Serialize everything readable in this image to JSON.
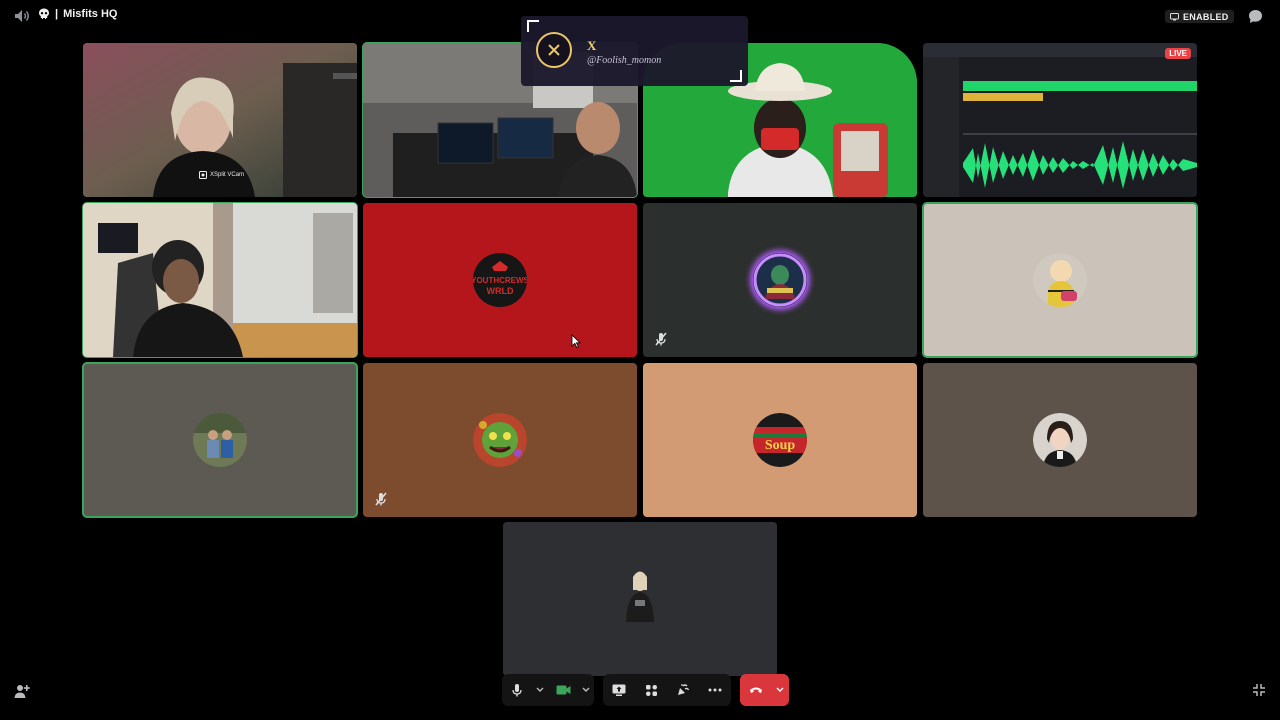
{
  "header": {
    "server_name": "Misfits HQ",
    "separator": "|",
    "badge_label": "ENABLED"
  },
  "notification": {
    "title": "X",
    "handle": "@Foolish_momon"
  },
  "tiles": [
    {
      "id": "cam-1",
      "label": "XSplit VCam",
      "bg": "#5a4a48"
    },
    {
      "id": "cam-2",
      "bg": "#3e3a37"
    },
    {
      "id": "cam-3",
      "bg": "#20a33a"
    },
    {
      "id": "cam-4",
      "live_label": "LIVE",
      "bg": "#1b1d22"
    },
    {
      "id": "cam-5",
      "bg": "#6b5a4f"
    },
    {
      "id": "avatar-youthcrews",
      "avatar_text_1": "YOUTHCREWS",
      "avatar_text_2": "WRLD",
      "bg": "#b4161b"
    },
    {
      "id": "avatar-glow",
      "bg": "#2b2f2d"
    },
    {
      "id": "avatar-cartoon",
      "bg": "#cbc3b9"
    },
    {
      "id": "avatar-photo",
      "bg": "#5c5a52"
    },
    {
      "id": "avatar-monster",
      "bg": "#7d4c2e"
    },
    {
      "id": "avatar-soup",
      "avatar_text_1": "Soup",
      "bg": "#d29b74"
    },
    {
      "id": "avatar-anime",
      "bg": "#5d534b"
    },
    {
      "id": "avatar-figure",
      "bg": "#2e2f33"
    }
  ],
  "colors": {
    "speaking_outline": "#3ba55c",
    "end_call": "#da373c",
    "video_on": "#3ba55c",
    "live": "#ed4245"
  },
  "icons": [
    "speaker-icon",
    "skull-icon",
    "tv-icon",
    "chat-bubble-icon",
    "close-icon",
    "mic-muted-icon",
    "microphone-icon",
    "camera-icon",
    "screen-share-icon",
    "activities-icon",
    "soundboard-icon",
    "more-icon",
    "hang-up-icon",
    "chevron-down-icon",
    "invite-icon",
    "exit-fullscreen-icon",
    "cursor-icon"
  ]
}
